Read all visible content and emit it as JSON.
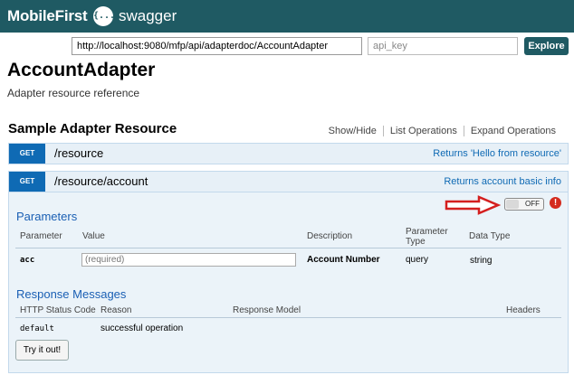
{
  "header": {
    "brand": "MobileFirst",
    "logo_glyph": "{...}",
    "product": "swagger",
    "bg_color": "#1f5a63"
  },
  "explore_bar": {
    "url_value": "http://localhost:9080/mfp/api/adapterdoc/AccountAdapter",
    "api_key_placeholder": "api_key",
    "explore_label": "Explore"
  },
  "api": {
    "title": "AccountAdapter",
    "description": "Adapter resource reference"
  },
  "resource": {
    "name": "Sample Adapter Resource",
    "ops": [
      "Show/Hide",
      "List Operations",
      "Expand Operations"
    ]
  },
  "operations": [
    {
      "method": "GET",
      "path": "/resource",
      "summary": "Returns 'Hello from resource'"
    },
    {
      "method": "GET",
      "path": "/resource/account",
      "summary": "Returns account basic info"
    }
  ],
  "auth_toggle": {
    "label": "OFF",
    "warning_icon": "exclamation-circle-icon"
  },
  "parameters": {
    "heading": "Parameters",
    "headers": {
      "parameter": "Parameter",
      "value": "Value",
      "description": "Description",
      "param_type_1": "Parameter",
      "param_type_2": "Type",
      "data_type": "Data Type"
    },
    "rows": [
      {
        "name": "acc",
        "value_placeholder": "(required)",
        "description": "Account Number",
        "param_type": "query",
        "data_type": "string"
      }
    ]
  },
  "responses": {
    "heading": "Response Messages",
    "headers": {
      "status": "HTTP Status Code",
      "reason": "Reason",
      "model": "Response Model",
      "headers": "Headers"
    },
    "rows": [
      {
        "status": "default",
        "reason": "successful operation"
      }
    ]
  },
  "try_label": "Try it out!",
  "colors": {
    "get_badge": "#0f6ab4",
    "op_bg": "#e7f0f7",
    "section_heading": "#1a5fb4",
    "arrow": "#d41f1f"
  }
}
